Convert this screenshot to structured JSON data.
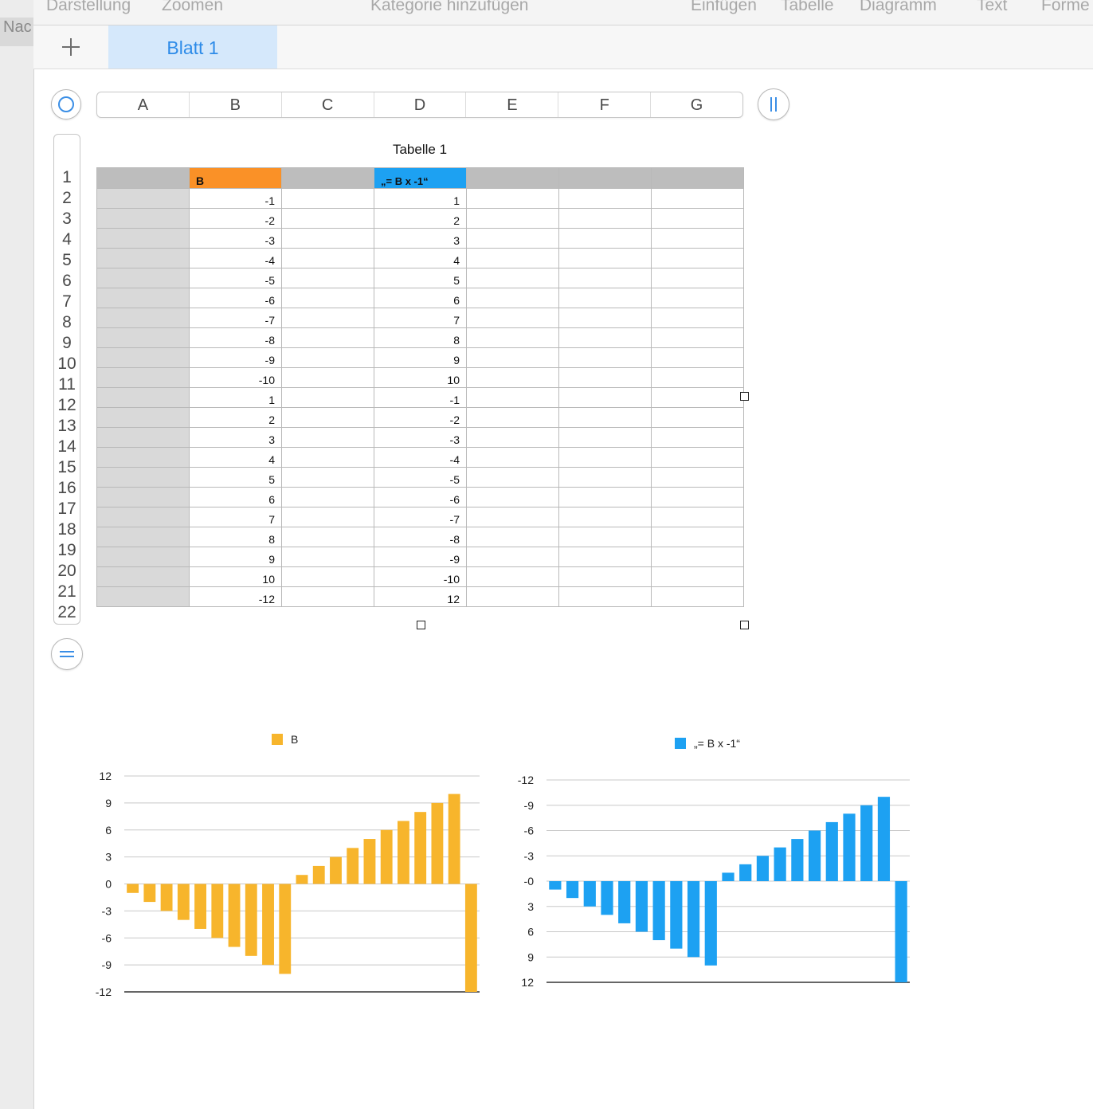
{
  "toolbar": {
    "items": [
      "Darstellung",
      "Zoomen",
      "Kategorie hinzufügen",
      "Einfügen",
      "Tabelle",
      "Diagramm",
      "Text",
      "Forme"
    ]
  },
  "sidebar": {
    "label": "Nac"
  },
  "sheets": {
    "active": "Blatt 1",
    "add_icon": "plus-icon"
  },
  "grid": {
    "columns": [
      "A",
      "B",
      "C",
      "D",
      "E",
      "F",
      "G"
    ],
    "rows": [
      "1",
      "2",
      "3",
      "4",
      "5",
      "6",
      "7",
      "8",
      "9",
      "10",
      "11",
      "12",
      "13",
      "14",
      "15",
      "16",
      "17",
      "18",
      "19",
      "20",
      "21",
      "22"
    ]
  },
  "table": {
    "title": "Tabelle 1",
    "header_b": "B",
    "header_d": "„= B x -1“",
    "col_b": [
      "-1",
      "-2",
      "-3",
      "-4",
      "-5",
      "-6",
      "-7",
      "-8",
      "-9",
      "-10",
      "1",
      "2",
      "3",
      "4",
      "5",
      "6",
      "7",
      "8",
      "9",
      "10",
      "-12"
    ],
    "col_d": [
      "1",
      "2",
      "3",
      "4",
      "5",
      "6",
      "7",
      "8",
      "9",
      "10",
      "-1",
      "-2",
      "-3",
      "-4",
      "-5",
      "-6",
      "-7",
      "-8",
      "-9",
      "-10",
      "12"
    ]
  },
  "chart_data": [
    {
      "type": "bar",
      "legend": "B",
      "color": "#f7b52c",
      "values": [
        -1,
        -2,
        -3,
        -4,
        -5,
        -6,
        -7,
        -8,
        -9,
        -10,
        1,
        2,
        3,
        4,
        5,
        6,
        7,
        8,
        9,
        10,
        -12
      ],
      "yticks": [
        "12",
        "9",
        "6",
        "3",
        "0",
        "-3",
        "-6",
        "-9",
        "-12"
      ],
      "ylim": [
        -12,
        12
      ],
      "inverted_axis": false,
      "grid": true
    },
    {
      "type": "bar",
      "legend": "„= B x -1“",
      "color": "#1da1f2",
      "values": [
        1,
        2,
        3,
        4,
        5,
        6,
        7,
        8,
        9,
        10,
        -1,
        -2,
        -3,
        -4,
        -5,
        -6,
        -7,
        -8,
        -9,
        -10,
        12
      ],
      "yticks": [
        "-12",
        "-9",
        "-6",
        "-3",
        "-0",
        "3",
        "6",
        "9",
        "12"
      ],
      "ylim": [
        -12,
        12
      ],
      "inverted_axis": true,
      "grid": true
    }
  ]
}
